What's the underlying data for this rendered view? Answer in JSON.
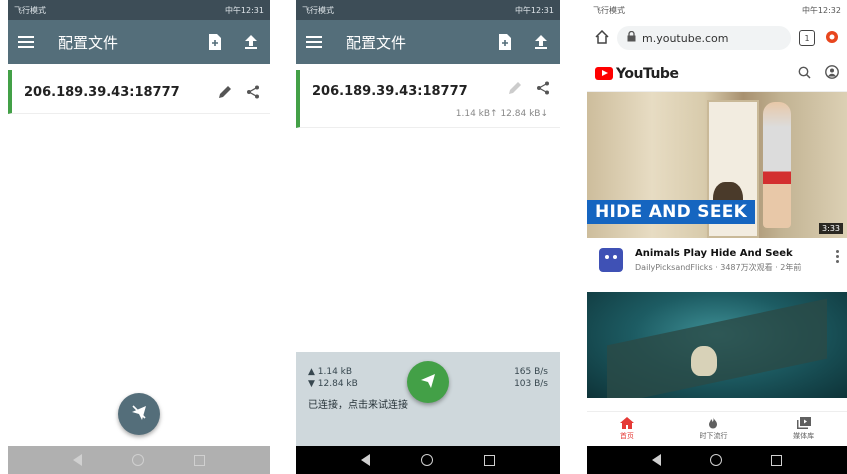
{
  "phone1": {
    "status_left": "飞行模式",
    "status_right": "中午12:31",
    "title": "配置文件",
    "profile": {
      "name": "206.189.39.43:18777"
    }
  },
  "phone2": {
    "status_left": "飞行模式",
    "status_right": "中午12:31",
    "title": "配置文件",
    "profile": {
      "name": "206.189.39.43:18777",
      "traffic": "1.14 kB↑ 12.84 kB↓"
    },
    "stats": {
      "up_total": "▲ 1.14 kB",
      "up_rate": "165 B/s",
      "down_total": "▼ 12.84 kB",
      "down_rate": "103 B/s",
      "status": "已连接，点击来试连接"
    }
  },
  "phone3": {
    "status_left": "飞行模式",
    "status_right": "中午12:32",
    "url": "m.youtube.com",
    "tab_count": "1",
    "brand": "YouTube",
    "video1": {
      "banner": "HIDE AND SEEK",
      "duration": "3:33",
      "title": "Animals Play Hide And Seek",
      "meta": "DailyPicksandFlicks · 3487万次观看 · 2年前"
    },
    "bottom_tabs": [
      {
        "label": "首页"
      },
      {
        "label": "时下流行"
      },
      {
        "label": "媒体库"
      }
    ]
  },
  "colors": {
    "appbar": "#546e7a",
    "connected_green": "#43a047",
    "disconnected_fab": "#546e7a",
    "youtube_red": "#ff0000"
  }
}
